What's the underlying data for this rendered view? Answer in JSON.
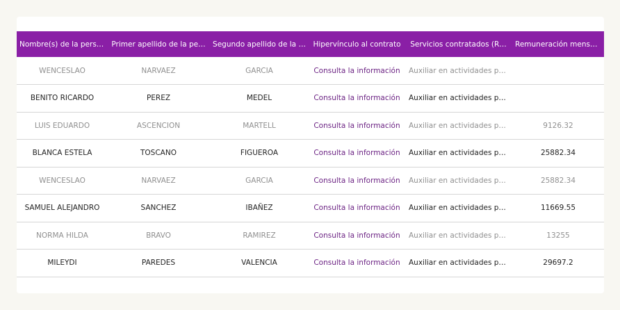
{
  "table": {
    "headers": [
      "Nombre(s) de la person…",
      "Primer apellido de la pe…",
      "Segundo apellido de la …",
      "Hipervínculo al contrato",
      "Servicios contratados (R…",
      "Remuneración mensual…"
    ],
    "rows": [
      [
        "WENCESLAO",
        "NARVAEZ",
        "GARCIA",
        "Consulta la información",
        "Auxiliar en actividades polít…",
        ""
      ],
      [
        "BENITO RICARDO",
        "PEREZ",
        "MEDEL",
        "Consulta la información",
        "Auxiliar en actividades polít…",
        ""
      ],
      [
        "LUIS EDUARDO",
        "ASCENCION",
        "MARTELL",
        "Consulta la información",
        "Auxiliar en actividades polít…",
        "9126.32"
      ],
      [
        "BLANCA ESTELA",
        "TOSCANO",
        "FIGUEROA",
        "Consulta la información",
        "Auxiliar en actividades polít…",
        "25882.34"
      ],
      [
        "WENCESLAO",
        "NARVAEZ",
        "GARCIA",
        "Consulta la información",
        "Auxiliar en actividades polít…",
        "25882.34"
      ],
      [
        "SAMUEL ALEJANDRO",
        "SANCHEZ",
        "IBAÑEZ",
        "Consulta la información",
        "Auxiliar en actividades polít…",
        "11669.55"
      ],
      [
        "NORMA HILDA",
        "BRAVO",
        "RAMIREZ",
        "Consulta la información",
        "Auxiliar en actividades polít…",
        "13255"
      ],
      [
        "MILEYDI",
        "PAREDES",
        "VALENCIA",
        "Consulta la información",
        "Auxiliar en actividades polít…",
        "29697.2"
      ]
    ]
  },
  "colors": {
    "header_bg": "#8a1fa6",
    "link": "#6b2283"
  }
}
